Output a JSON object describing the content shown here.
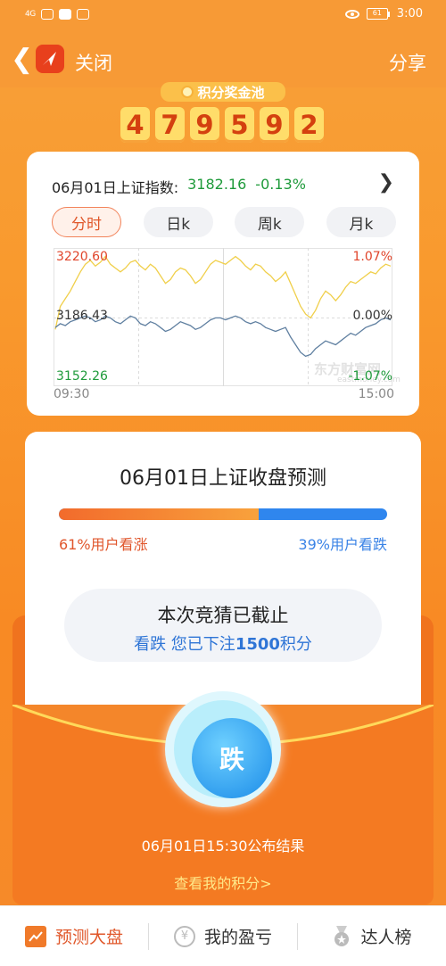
{
  "status_bar": {
    "signal": "4G",
    "battery": "61",
    "time": "3:00"
  },
  "nav": {
    "close_label": "关闭",
    "share_label": "分享"
  },
  "jackpot": {
    "title": "积分奖金池",
    "digits": [
      "4",
      "7",
      "9",
      "5",
      "9",
      "2"
    ]
  },
  "index": {
    "title": "06月01日上证指数:",
    "value": "3182.16",
    "change": "-0.13%",
    "tabs": [
      "分时",
      "日k",
      "周k",
      "月k"
    ],
    "active_tab": "分时"
  },
  "chart_data": {
    "type": "line",
    "x_range": [
      "09:30",
      "15:00"
    ],
    "y_labels": {
      "high": "3220.60",
      "mid": "3186.43",
      "low": "3152.26"
    },
    "pct_labels": {
      "high": "1.07%",
      "mid": "0.00%",
      "low": "-1.07%"
    },
    "ylim": [
      3152.26,
      3220.6
    ],
    "series": [
      {
        "color": "#f0cf4a",
        "values": [
          3180,
          3192,
          3196,
          3200,
          3205,
          3210,
          3214,
          3216,
          3213,
          3215,
          3218,
          3214,
          3212,
          3210,
          3212,
          3215,
          3216,
          3213,
          3211,
          3214,
          3212,
          3208,
          3204,
          3206,
          3210,
          3212,
          3211,
          3208,
          3204,
          3206,
          3210,
          3214,
          3216,
          3215,
          3214,
          3216,
          3218,
          3216,
          3213,
          3211,
          3214,
          3213,
          3210,
          3208,
          3205,
          3207,
          3210,
          3204,
          3198,
          3192,
          3188,
          3186,
          3190,
          3196,
          3200,
          3198,
          3195,
          3198,
          3202,
          3205,
          3204,
          3206,
          3208,
          3210,
          3209,
          3212,
          3214,
          3213
        ]
      },
      {
        "color": "#5f7fa0",
        "values": [
          3181,
          3183,
          3182,
          3184,
          3185,
          3186,
          3187,
          3186,
          3184,
          3185,
          3187,
          3186,
          3184,
          3183,
          3185,
          3187,
          3186,
          3183,
          3182,
          3184,
          3183,
          3181,
          3179,
          3180,
          3182,
          3184,
          3183,
          3182,
          3180,
          3181,
          3183,
          3185,
          3186,
          3186,
          3185,
          3186,
          3187,
          3186,
          3184,
          3183,
          3184,
          3183,
          3181,
          3180,
          3179,
          3180,
          3181,
          3176,
          3172,
          3168,
          3166,
          3167,
          3170,
          3172,
          3174,
          3173,
          3172,
          3174,
          3176,
          3178,
          3177,
          3179,
          3181,
          3182,
          3183,
          3185,
          3186,
          3185
        ]
      }
    ],
    "watermark": "东方财富网",
    "watermark_sub": "eastmoney.com"
  },
  "prediction": {
    "title": "06月01日上证收盘预测",
    "up_fraction": 0.61,
    "up_label": "61%用户看涨",
    "down_label": "39%用户看跌",
    "closed_text": "本次竞猜已截止",
    "bet_prefix": "看跌 您已下注",
    "bet_amount": "1500",
    "bet_suffix": "积分",
    "fall_button": "跌",
    "result_time": "06月01日15:30公布结果",
    "my_points_link": "查看我的积分>"
  },
  "bottom_nav": [
    {
      "label": "预测大盘",
      "icon": "trend-chart-icon",
      "active": true
    },
    {
      "label": "我的盈亏",
      "icon": "yen-coin-icon",
      "active": false
    },
    {
      "label": "达人榜",
      "icon": "medal-icon",
      "active": false
    }
  ],
  "colors": {
    "orange": "#f79a36",
    "up": "#e0442a",
    "down": "#1e9a3a",
    "blue": "#2f86ee"
  }
}
